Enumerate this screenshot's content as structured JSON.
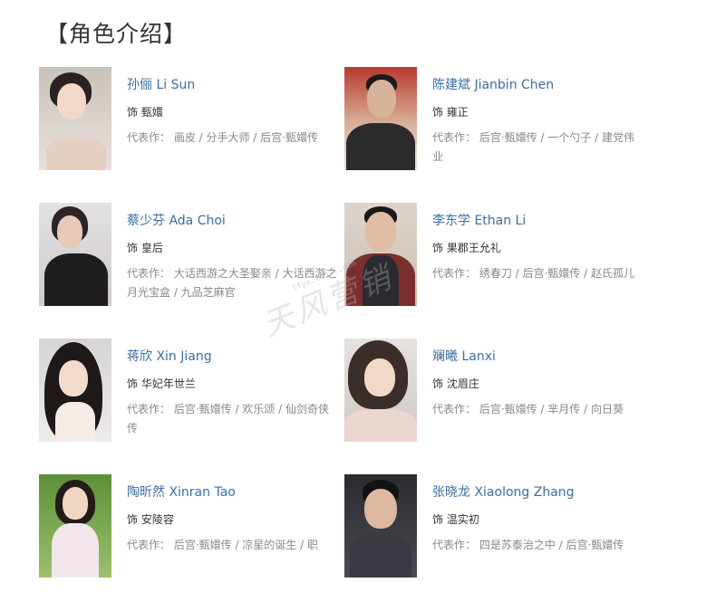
{
  "heading": "【角色介绍】",
  "cards": [
    {
      "name": "孙俪 Li Sun",
      "role": "饰 甄嬛",
      "works": "代表作： 画皮 / 分手大师 / 后宫·甄嬛传"
    },
    {
      "name": "陈建斌 Jianbin Chen",
      "role": "饰 雍正",
      "works": "代表作： 后宫·甄嬛传 / 一个勺子 / 建党伟业"
    },
    {
      "name": "蔡少芬 Ada Choi",
      "role": "饰 皇后",
      "works": "代表作： 大话西游之大圣娶亲 / 大话西游之月光宝盒 / 九品芝麻官"
    },
    {
      "name": "李东学 Ethan Li",
      "role": "饰 果郡王允礼",
      "works": "代表作： 绣春刀 / 后宫·甄嬛传 / 赵氏孤儿"
    },
    {
      "name": "蒋欣 Xin Jiang",
      "role": "饰 华妃年世兰",
      "works": "代表作： 后宫·甄嬛传 / 欢乐颂 / 仙剑奇侠传"
    },
    {
      "name": "斓曦 Lanxi",
      "role": "饰 沈眉庄",
      "works": "代表作： 后宫·甄嬛传 / 芈月传 / 向日葵"
    },
    {
      "name": "陶昕然 Xinran Tao",
      "role": "饰 安陵容",
      "works": "代表作： 后宫·甄嬛传 / 凉星的诞生 / 职"
    },
    {
      "name": "张晓龙 Xiaolong Zhang",
      "role": "饰 温实初",
      "works": "代表作： 四是苏泰治之中 / 后宫·甄嬛传"
    }
  ],
  "watermark": "天风营销",
  "watermark_sub": "tfyx.tmall.com"
}
